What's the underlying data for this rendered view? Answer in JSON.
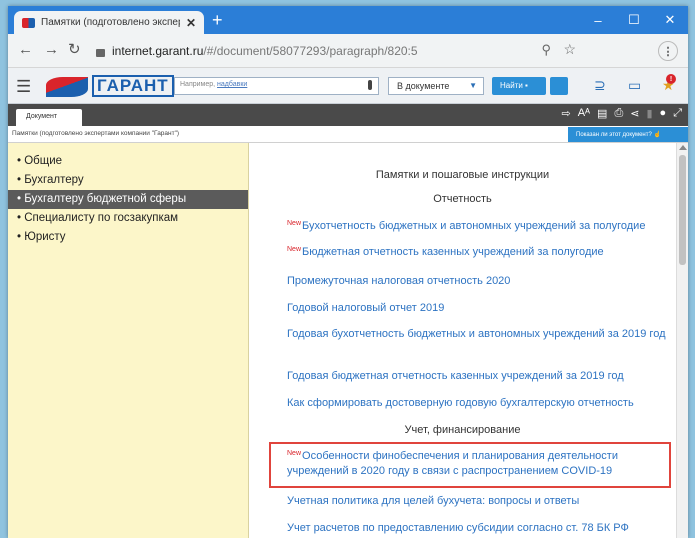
{
  "browser": {
    "tab_title": "Памятки (подготовлено экспер",
    "tab_close": "✕",
    "new_tab": "+",
    "url_host": "internet.garant.ru",
    "url_rest": "/#/document/58077293/paragraph/820:5"
  },
  "toolbar": {
    "logo_text": "ГАРАНТ",
    "search_placeholder_prefix": "Например,",
    "search_placeholder_example": "надбавки",
    "scope": "В документе",
    "find_button": "Найти"
  },
  "docbar": {
    "tab_label": "Документ"
  },
  "breadcrumb": {
    "text": "Памятки (подготовлено экспертами компании \"Гарант\")",
    "button": "Показан ли этот документ?"
  },
  "sidebar": {
    "items": [
      {
        "label": "• Общие"
      },
      {
        "label": "• Бухгалтеру"
      },
      {
        "label": "• Бухгалтеру бюджетной сферы"
      },
      {
        "label": "• Специалисту по госзакупкам"
      },
      {
        "label": "• Юристу"
      }
    ]
  },
  "main": {
    "heading1": "Памятки и пошаговые инструкции",
    "heading2": "Отчетность",
    "heading3": "Учет, финансирование",
    "new_badge": "New",
    "links": [
      "Бухотчетность бюджетных и автономных учреждений за полугодие",
      "Бюджетная отчетность казенных учреждений за полугодие",
      "Промежуточная налоговая отчетность 2020",
      "Годовой налоговый отчет 2019",
      "Годовая бухотчетность бюджетных и автономных учреждений за 2019 год",
      "Годовая бюджетная отчетность казенных учреждений за 2019 год",
      "Как сформировать достоверную годовую бухгалтерскую отчетность",
      "Особенности финобеспечения и планирования деятельности учреждений в 2020 году в связи с распространением COVID-19",
      "Учетная политика для целей бухучета: вопросы и ответы",
      "Учет расчетов по предоставлению субсидии согласно ст. 78 БК РФ"
    ]
  }
}
